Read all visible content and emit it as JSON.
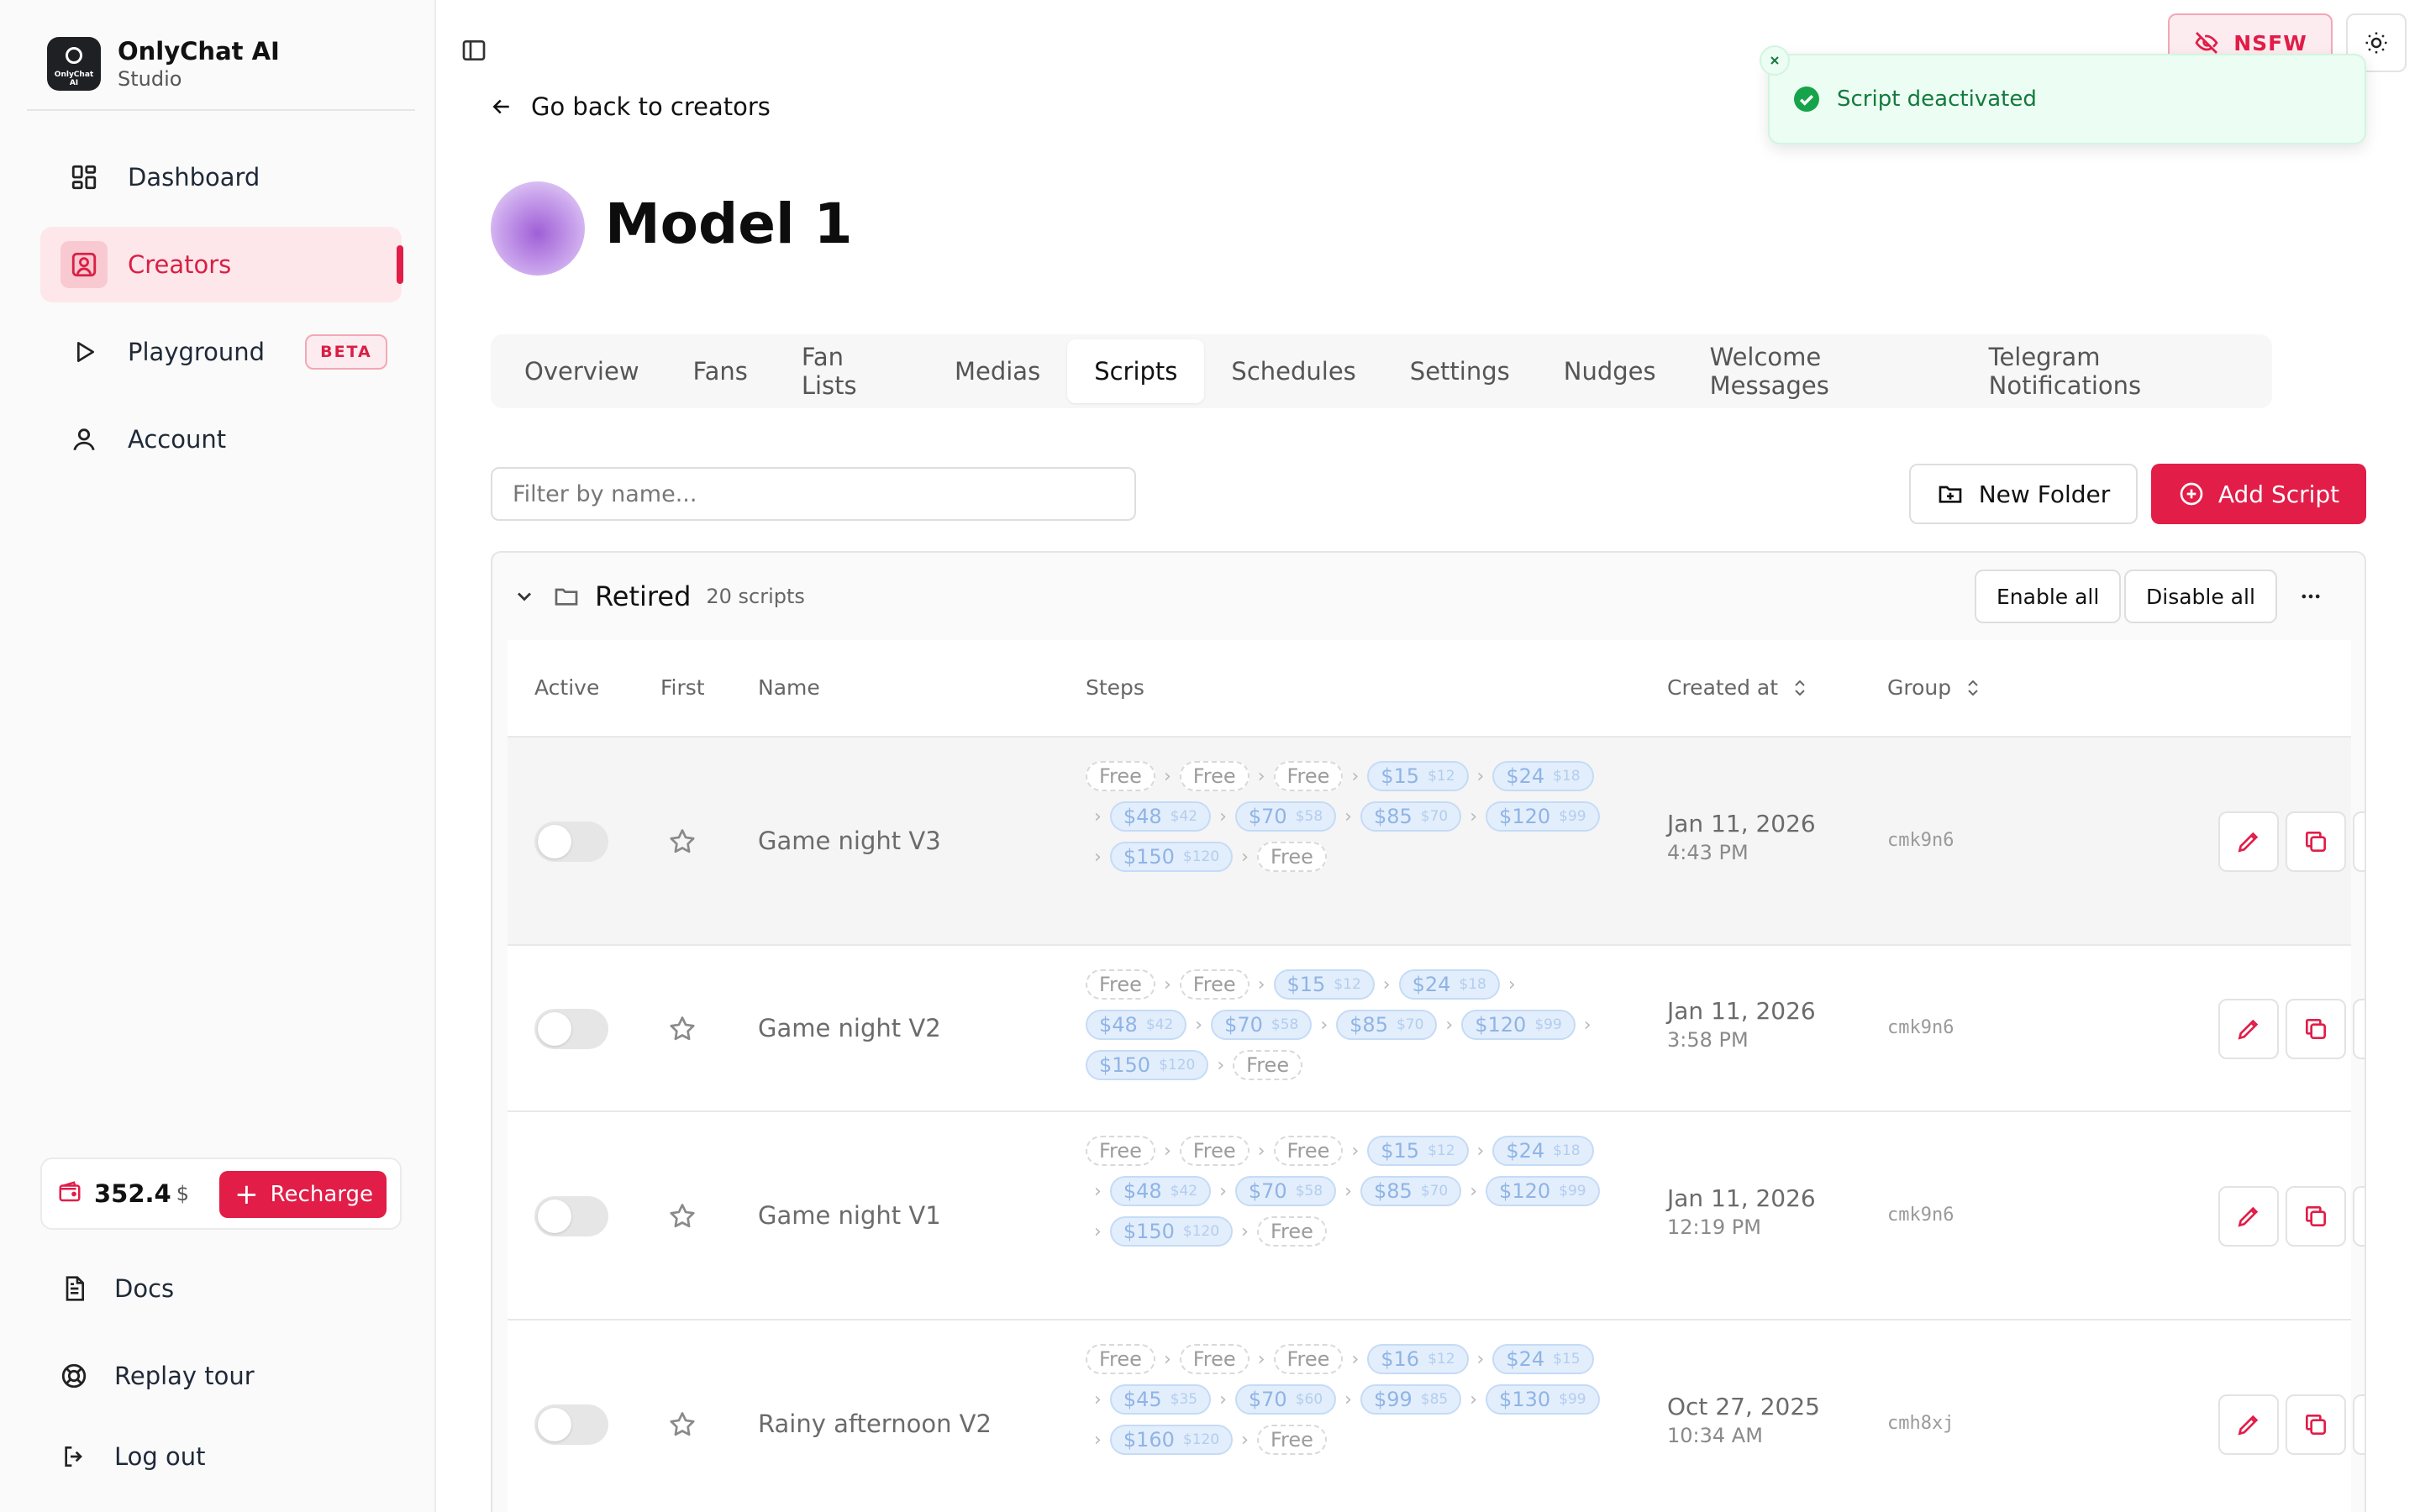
{
  "brand": {
    "name": "OnlyChat AI",
    "subtitle": "Studio",
    "logo_text": "OnlyChat AI"
  },
  "sidebar": {
    "items": [
      {
        "label": "Dashboard",
        "icon": "dashboard-grid-icon"
      },
      {
        "label": "Creators",
        "icon": "creator-portrait-icon",
        "active": true
      },
      {
        "label": "Playground",
        "icon": "play-icon",
        "badge": "BETA"
      },
      {
        "label": "Account",
        "icon": "user-icon"
      }
    ],
    "balance": {
      "amount": "352.4",
      "currency": "$",
      "recharge_label": "Recharge"
    },
    "bottom": [
      {
        "label": "Docs",
        "icon": "document-icon"
      },
      {
        "label": "Replay tour",
        "icon": "lifebuoy-icon"
      },
      {
        "label": "Log out",
        "icon": "logout-icon"
      }
    ]
  },
  "header": {
    "back_label": "Go back to creators",
    "nsfw_label": "NSFW"
  },
  "toast": {
    "message": "Script deactivated"
  },
  "creator": {
    "name": "Model 1"
  },
  "tabs": [
    {
      "label": "Overview"
    },
    {
      "label": "Fans"
    },
    {
      "label": "Fan Lists"
    },
    {
      "label": "Medias"
    },
    {
      "label": "Scripts",
      "active": true
    },
    {
      "label": "Schedules"
    },
    {
      "label": "Settings"
    },
    {
      "label": "Nudges"
    },
    {
      "label": "Welcome Messages"
    },
    {
      "label": "Telegram Notifications"
    }
  ],
  "toolbar": {
    "filter_placeholder": "Filter by name...",
    "new_folder_label": "New Folder",
    "add_script_label": "Add Script"
  },
  "folder": {
    "name": "Retired",
    "count": "20 scripts",
    "enable_all": "Enable all",
    "disable_all": "Disable all"
  },
  "columns": {
    "active": "Active",
    "first": "First",
    "name": "Name",
    "steps": "Steps",
    "created": "Created at",
    "group": "Group"
  },
  "rows": [
    {
      "name": "Game night V3",
      "date": "Jan 11, 2026",
      "time": "4:43 PM",
      "group": "cmk9n6",
      "active": false,
      "hover": true,
      "steps": [
        {
          "label": "Free"
        },
        {
          "label": "Free"
        },
        {
          "label": "Free"
        },
        {
          "label": "$15",
          "old": "$12"
        },
        {
          "label": "$24",
          "old": "$18"
        },
        {
          "label": "$48",
          "old": "$42"
        },
        {
          "label": "$70",
          "old": "$58"
        },
        {
          "label": "$85",
          "old": "$70"
        },
        {
          "label": "$120",
          "old": "$99"
        },
        {
          "label": "$150",
          "old": "$120"
        },
        {
          "label": "Free"
        }
      ]
    },
    {
      "name": "Game night V2",
      "date": "Jan 11, 2026",
      "time": "3:58 PM",
      "group": "cmk9n6",
      "active": false,
      "steps": [
        {
          "label": "Free"
        },
        {
          "label": "Free"
        },
        {
          "label": "$15",
          "old": "$12"
        },
        {
          "label": "$24",
          "old": "$18"
        },
        {
          "label": "$48",
          "old": "$42"
        },
        {
          "label": "$70",
          "old": "$58"
        },
        {
          "label": "$85",
          "old": "$70"
        },
        {
          "label": "$120",
          "old": "$99"
        },
        {
          "label": "$150",
          "old": "$120"
        },
        {
          "label": "Free"
        }
      ]
    },
    {
      "name": "Game night V1",
      "date": "Jan 11, 2026",
      "time": "12:19 PM",
      "group": "cmk9n6",
      "active": false,
      "steps": [
        {
          "label": "Free"
        },
        {
          "label": "Free"
        },
        {
          "label": "Free"
        },
        {
          "label": "$15",
          "old": "$12"
        },
        {
          "label": "$24",
          "old": "$18"
        },
        {
          "label": "$48",
          "old": "$42"
        },
        {
          "label": "$70",
          "old": "$58"
        },
        {
          "label": "$85",
          "old": "$70"
        },
        {
          "label": "$120",
          "old": "$99"
        },
        {
          "label": "$150",
          "old": "$120"
        },
        {
          "label": "Free"
        }
      ]
    },
    {
      "name": "Rainy afternoon V2",
      "date": "Oct 27, 2025",
      "time": "10:34 AM",
      "group": "cmh8xj",
      "active": false,
      "steps": [
        {
          "label": "Free"
        },
        {
          "label": "Free"
        },
        {
          "label": "Free"
        },
        {
          "label": "$16",
          "old": "$12"
        },
        {
          "label": "$24",
          "old": "$15"
        },
        {
          "label": "$45",
          "old": "$35"
        },
        {
          "label": "$70",
          "old": "$60"
        },
        {
          "label": "$99",
          "old": "$85"
        },
        {
          "label": "$130",
          "old": "$99"
        },
        {
          "label": "$160",
          "old": "$120"
        },
        {
          "label": "Free"
        }
      ]
    }
  ],
  "colors": {
    "accent": "#e11d48",
    "success": "#16a34a",
    "chip_paid": "#e3eefc"
  }
}
